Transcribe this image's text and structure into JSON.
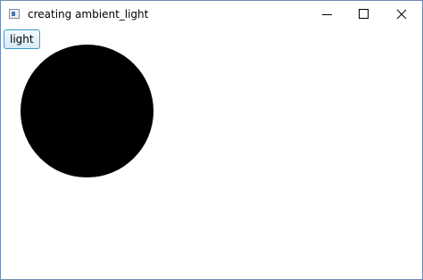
{
  "window": {
    "title": "creating ambient_light",
    "icon": "app-icon"
  },
  "titlebar": {
    "controls": [
      "minimize-icon",
      "maximize-icon",
      "close-icon"
    ]
  },
  "toolbar": {
    "light_label": "light"
  },
  "scene": {
    "shape": "circle",
    "fill_color": "#000000",
    "background": "#ffffff"
  },
  "theme": {
    "button_border": "#3a9bd1",
    "window_border": "#6b8bb0"
  }
}
